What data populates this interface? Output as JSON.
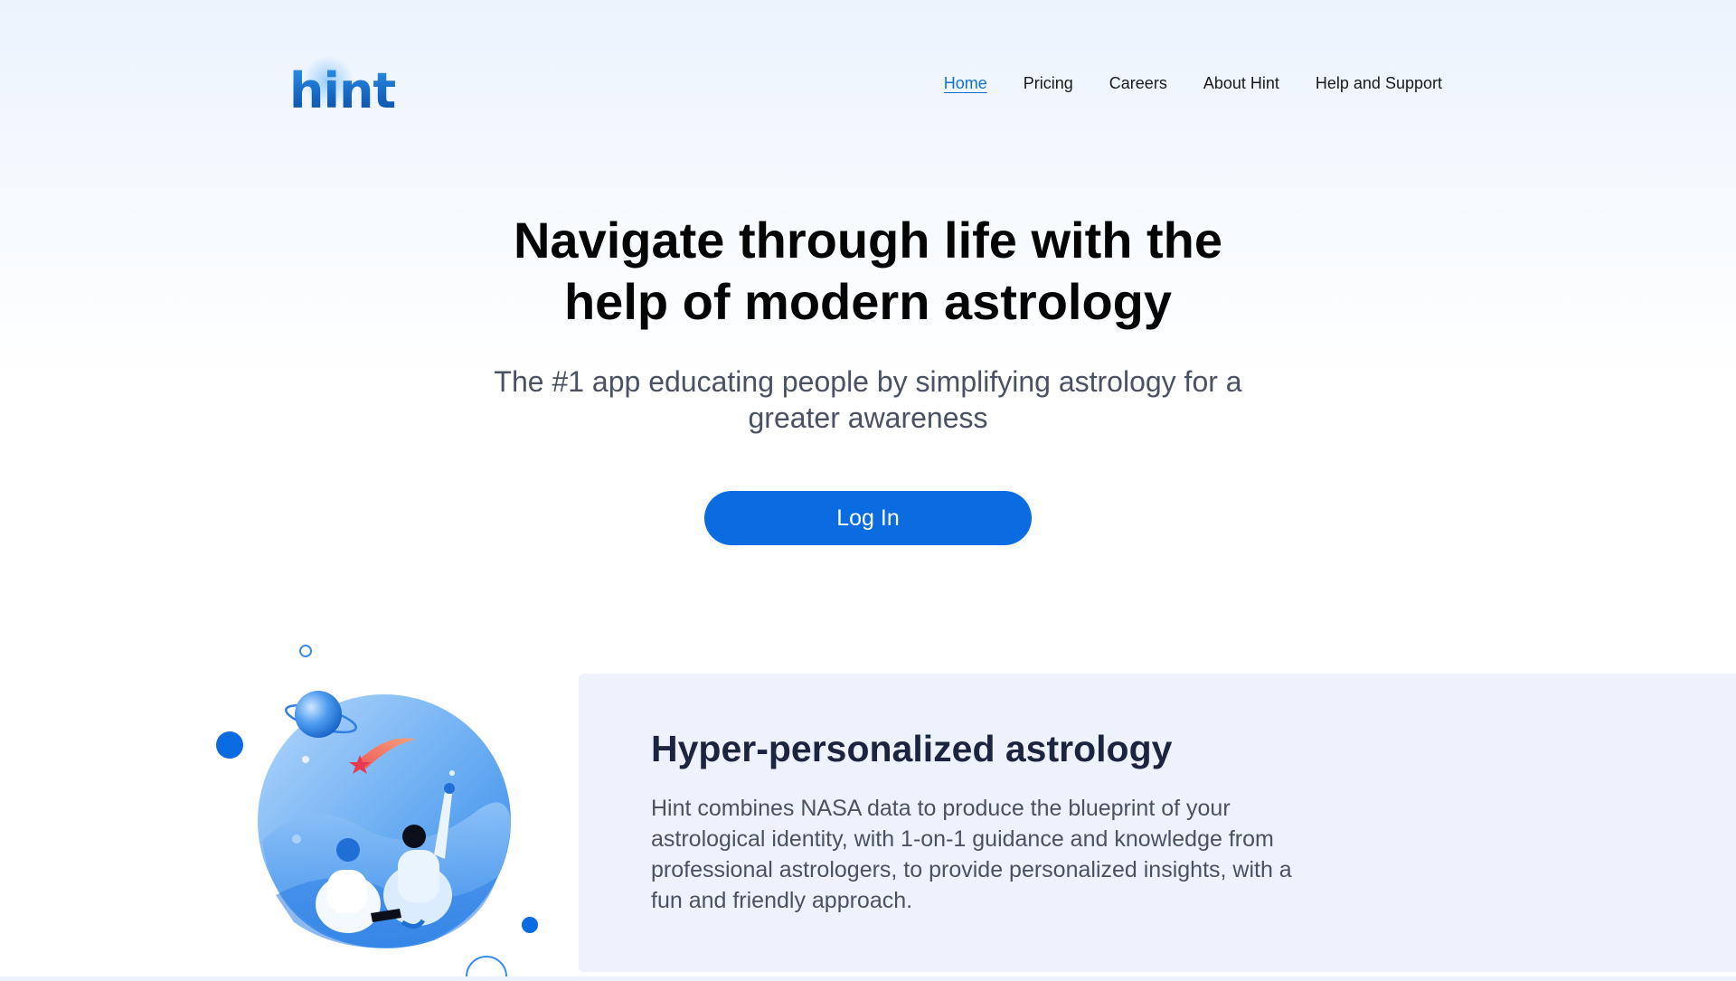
{
  "brand": {
    "logo_text": "hint"
  },
  "nav": {
    "items": [
      {
        "label": "Home",
        "active": true
      },
      {
        "label": "Pricing",
        "active": false
      },
      {
        "label": "Careers",
        "active": false
      },
      {
        "label": "About Hint",
        "active": false
      },
      {
        "label": "Help and Support",
        "active": false
      }
    ]
  },
  "hero": {
    "title": "Navigate through life with the help of modern astrology",
    "subtitle": "The #1 app educating people by simplifying astrology for a greater awareness",
    "login_label": "Log In"
  },
  "feature": {
    "title": "Hyper-personalized astrology",
    "body": "Hint combines NASA data to produce the blueprint of your astrological identity, with 1-on-1 guidance and knowledge from professional astrologers, to provide personalized insights, with a fun and friendly approach."
  },
  "colors": {
    "accent": "#0b6be0",
    "nav_active": "#1172d6",
    "panel_bg": "#eef2fc",
    "title_dark": "#1c2540",
    "body_gray": "#4a5163"
  },
  "icons": {
    "illustration": "astrology-illustration"
  }
}
